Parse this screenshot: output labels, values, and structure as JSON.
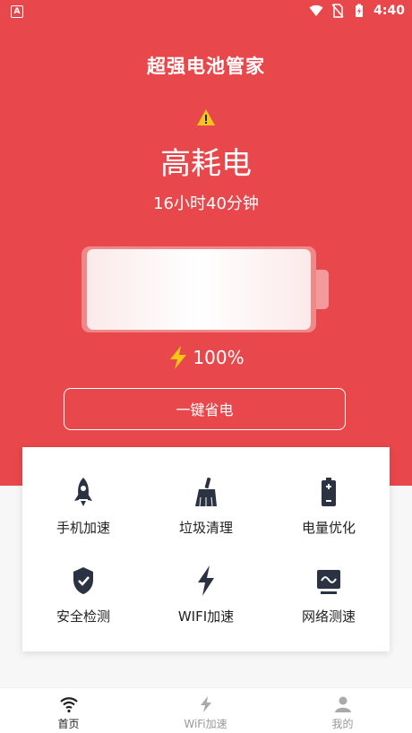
{
  "status_bar": {
    "time": "4:40",
    "app_icon_letter": "A"
  },
  "header": {
    "title": "超强电池管家"
  },
  "battery": {
    "status": "高耗电",
    "remaining_time": "16小时40分钟",
    "percent_text": "100%",
    "level_fraction": 1.0
  },
  "save_button": {
    "label": "一键省电"
  },
  "tools": [
    {
      "label": "手机加速",
      "icon": "rocket-icon"
    },
    {
      "label": "垃圾清理",
      "icon": "broom-icon"
    },
    {
      "label": "电量优化",
      "icon": "battery-icon"
    },
    {
      "label": "安全检测",
      "icon": "shield-check-icon"
    },
    {
      "label": "WIFI加速",
      "icon": "lightning-icon"
    },
    {
      "label": "网络测速",
      "icon": "monitor-icon"
    }
  ],
  "bottom_nav": [
    {
      "label": "首页",
      "icon": "wifi-icon",
      "active": true
    },
    {
      "label": "WiFi加速",
      "icon": "lightning-icon",
      "active": false
    },
    {
      "label": "我的",
      "icon": "user-icon",
      "active": false
    }
  ],
  "colors": {
    "primary": "#e8474b",
    "icon_dark": "#2b3343",
    "inactive": "#aaaaaa"
  }
}
